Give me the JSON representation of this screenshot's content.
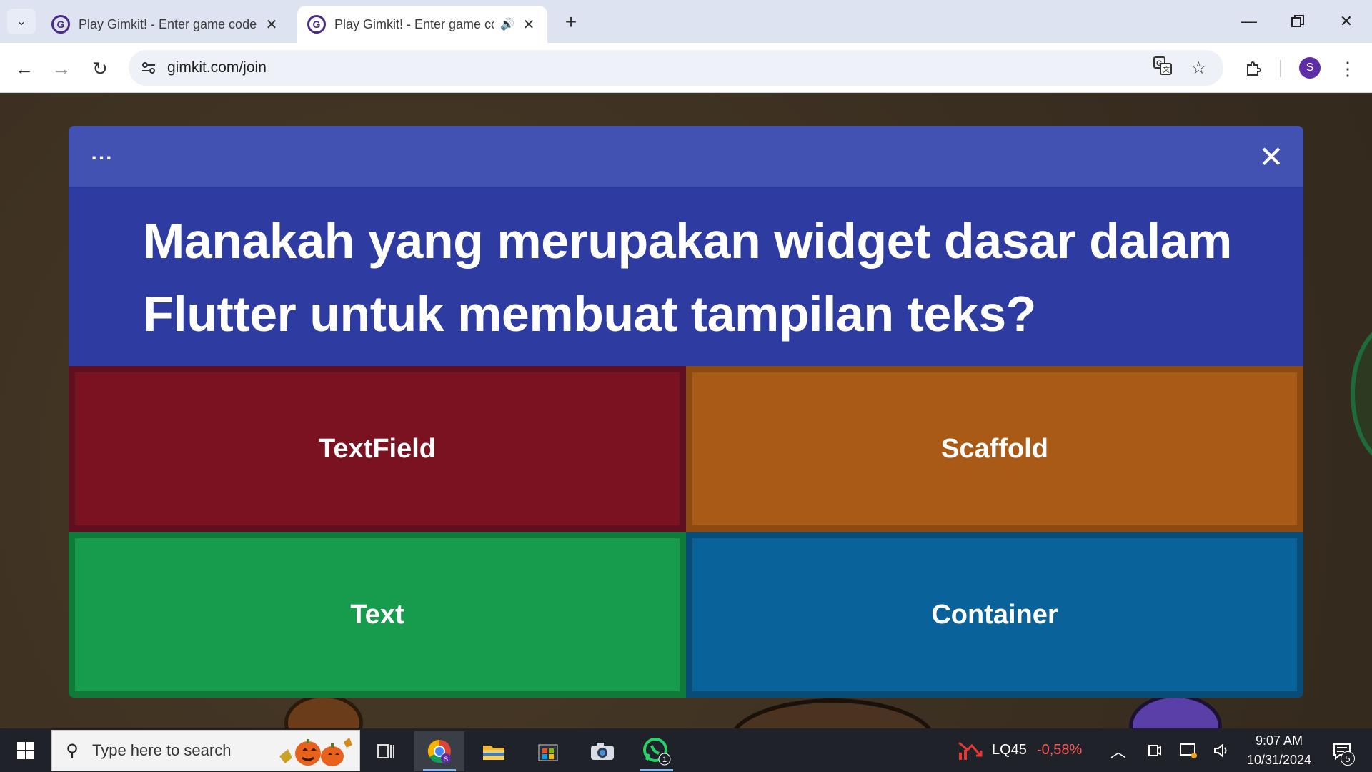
{
  "browser": {
    "tabs": [
      {
        "title": "Play Gimkit! - Enter game code",
        "favicon": "G",
        "active": false
      },
      {
        "title": "Play Gimkit! - Enter game code",
        "favicon": "G",
        "active": true,
        "audio": true
      }
    ],
    "address": "gimkit.com/join",
    "profile_initial": "S",
    "icons": {
      "translate": "translate-icon",
      "bookmark": "star-icon",
      "extensions": "puzzle-icon",
      "menu": "kebab-menu-icon"
    }
  },
  "modal": {
    "menu_label": "...",
    "close_label": "✕",
    "question": "Manakah yang merupakan widget dasar dalam Flutter untuk membuat tampilan teks?",
    "answers": [
      {
        "label": "TextField",
        "color": "#7a1222"
      },
      {
        "label": "Scaffold",
        "color": "#a85a16"
      },
      {
        "label": "Text",
        "color": "#169c4c"
      },
      {
        "label": "Container",
        "color": "#09629a"
      }
    ],
    "header_color": "#4152b3",
    "body_color": "#2e3ba0"
  },
  "taskbar": {
    "search_placeholder": "Type here to search",
    "whatsapp_badge": "1",
    "stock": {
      "name": "LQ45",
      "change": "-0,58%"
    },
    "time": "9:07 AM",
    "date": "10/31/2024",
    "notification_count": "5"
  }
}
